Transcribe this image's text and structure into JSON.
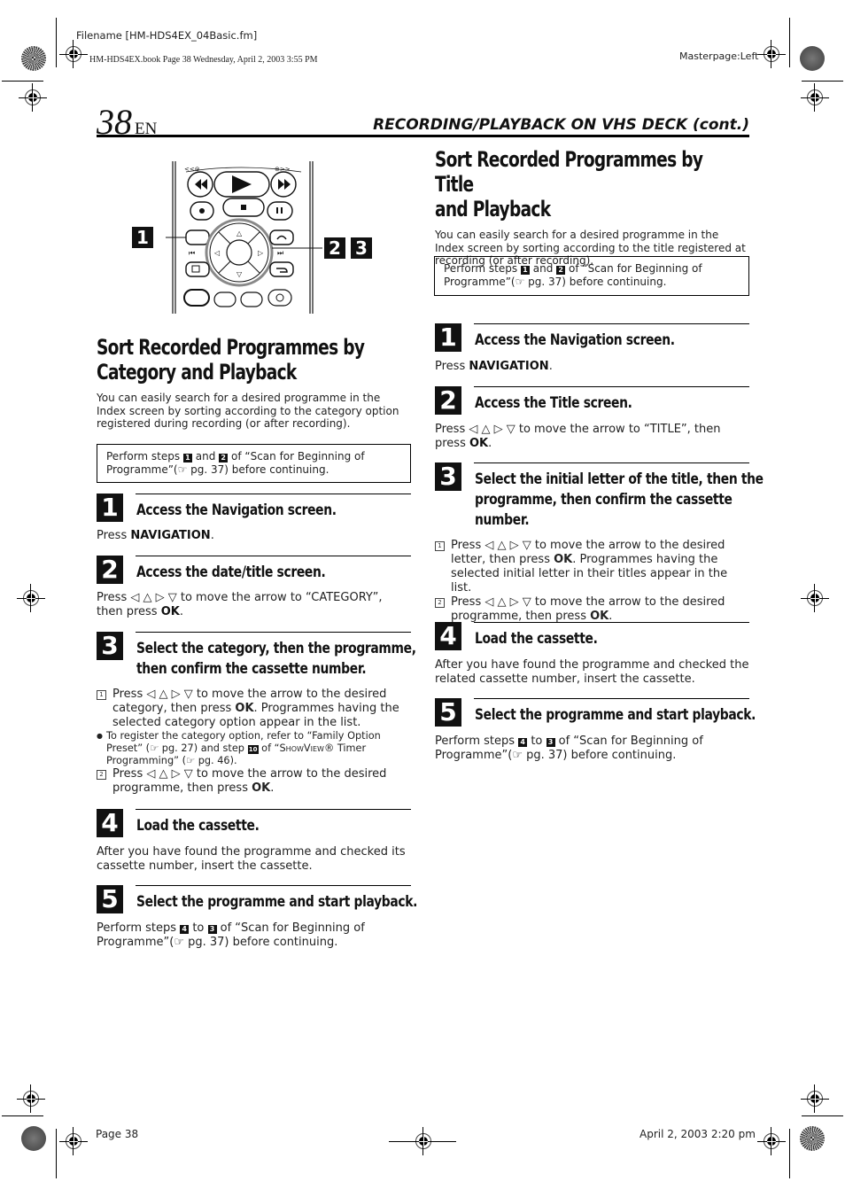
{
  "print_meta": {
    "filename": "Filename [HM-HDS4EX_04Basic.fm]",
    "book_line": "HM-HDS4EX.book  Page 38  Wednesday, April 2, 2003  3:55 PM",
    "masterpage": "Masterpage:Left",
    "footer_page": "Page 38",
    "footer_date": "April 2, 2003 2:20 pm"
  },
  "header": {
    "page_number": "38",
    "lang": "EN",
    "running_head": "RECORDING/PLAYBACK ON VHS DECK (cont.)"
  },
  "figure": {
    "callout_left": "1",
    "callout_right_a": "2",
    "callout_right_b": "3",
    "icons": [
      "rewind-button",
      "play-button",
      "fast-forward-button",
      "record-button",
      "stop-button",
      "pause-button",
      "navigation-button",
      "skip-back-icon",
      "skip-forward-icon",
      "up-arrow",
      "down-arrow",
      "left-arrow",
      "right-arrow",
      "ok-button",
      "return-button"
    ]
  },
  "left": {
    "title_line1": "Sort Recorded Programmes by",
    "title_line2": "Category and Playback",
    "intro": "You can easily search for a desired programme in the Index screen by sorting according to the category option registered during recording (or after recording).",
    "note": {
      "pre": "Perform steps ",
      "s1": "1",
      "mid": " and ",
      "s2": "2",
      "post": " of “Scan for Beginning of Programme”(☞ pg. 37) before continuing."
    },
    "steps": [
      {
        "num": "1",
        "title": "Access the Navigation screen.",
        "body_pre": "Press ",
        "body_bold": "NAVIGATION",
        "body_post": "."
      },
      {
        "num": "2",
        "title": "Access the date/title screen.",
        "body_pre": "Press ◁ △ ▷ ▽ to move the arrow to “CATEGORY”, then press ",
        "body_bold": "OK",
        "body_post": "."
      },
      {
        "num": "3",
        "title_line1": "Select the category, then the programme,",
        "title_line2": "then confirm the cassette number.",
        "sub1_num": "1",
        "sub1_pre": "Press ◁ △ ▷ ▽ to move the arrow to the desired category, then press ",
        "sub1_bold": "OK",
        "sub1_post": ". Programmes having the selected category option appear in the list.",
        "bullet_pre": "To register the category option, refer to “Family Option Preset” (☞ pg. 27) and step ",
        "bullet_step": "10",
        "bullet_mid": " of “",
        "bullet_sc": "ShowView",
        "bullet_post": "® Timer Programming” (☞ pg. 46).",
        "sub2_num": "2",
        "sub2_pre": "Press ◁ △ ▷ ▽ to move the arrow to the desired programme, then press ",
        "sub2_bold": "OK",
        "sub2_post": "."
      },
      {
        "num": "4",
        "title": "Load the cassette.",
        "body": "After you have found the programme and checked its cassette number, insert the cassette."
      },
      {
        "num": "5",
        "title": "Select the programme and start playback.",
        "body_pre": "Perform steps ",
        "s_a": "4",
        "body_mid": " to ",
        "s_b": "3",
        "body_post": " of “Scan for Beginning of Programme”(☞ pg. 37) before continuing."
      }
    ]
  },
  "right": {
    "title_line1": "Sort Recorded Programmes by Title",
    "title_line2": "and Playback",
    "intro": "You can easily search for a desired programme in the Index screen by sorting according to the title registered at recording (or after recording).",
    "note": {
      "pre": "Perform steps ",
      "s1": "1",
      "mid": " and ",
      "s2": "2",
      "post": " of “Scan for Beginning of Programme”(☞ pg. 37) before continuing."
    },
    "steps": [
      {
        "num": "1",
        "title": "Access the Navigation screen.",
        "body_pre": "Press ",
        "body_bold": "NAVIGATION",
        "body_post": "."
      },
      {
        "num": "2",
        "title": "Access the Title screen.",
        "body_pre": "Press ◁ △ ▷ ▽ to move the arrow to “TITLE”, then press ",
        "body_bold": "OK",
        "body_post": "."
      },
      {
        "num": "3",
        "title_line1": "Select the initial letter of the title, then the",
        "title_line2": "programme, then confirm the cassette",
        "title_line3": "number.",
        "sub1_num": "1",
        "sub1_pre": "Press ◁ △ ▷ ▽ to move the arrow to the desired letter, then press ",
        "sub1_bold": "OK",
        "sub1_post": ". Programmes having the selected initial letter in their titles appear in the list.",
        "sub2_num": "2",
        "sub2_pre": "Press ◁ △ ▷ ▽ to move the arrow to the desired programme, then press ",
        "sub2_bold": "OK",
        "sub2_post": "."
      },
      {
        "num": "4",
        "title": "Load the cassette.",
        "body": "After you have found the programme and checked the related cassette number, insert the cassette."
      },
      {
        "num": "5",
        "title": "Select the programme and start playback.",
        "body_pre": "Perform steps ",
        "s_a": "4",
        "body_mid": " to ",
        "s_b": "3",
        "body_post": " of “Scan for Beginning of Programme”(☞ pg. 37) before continuing."
      }
    ]
  }
}
